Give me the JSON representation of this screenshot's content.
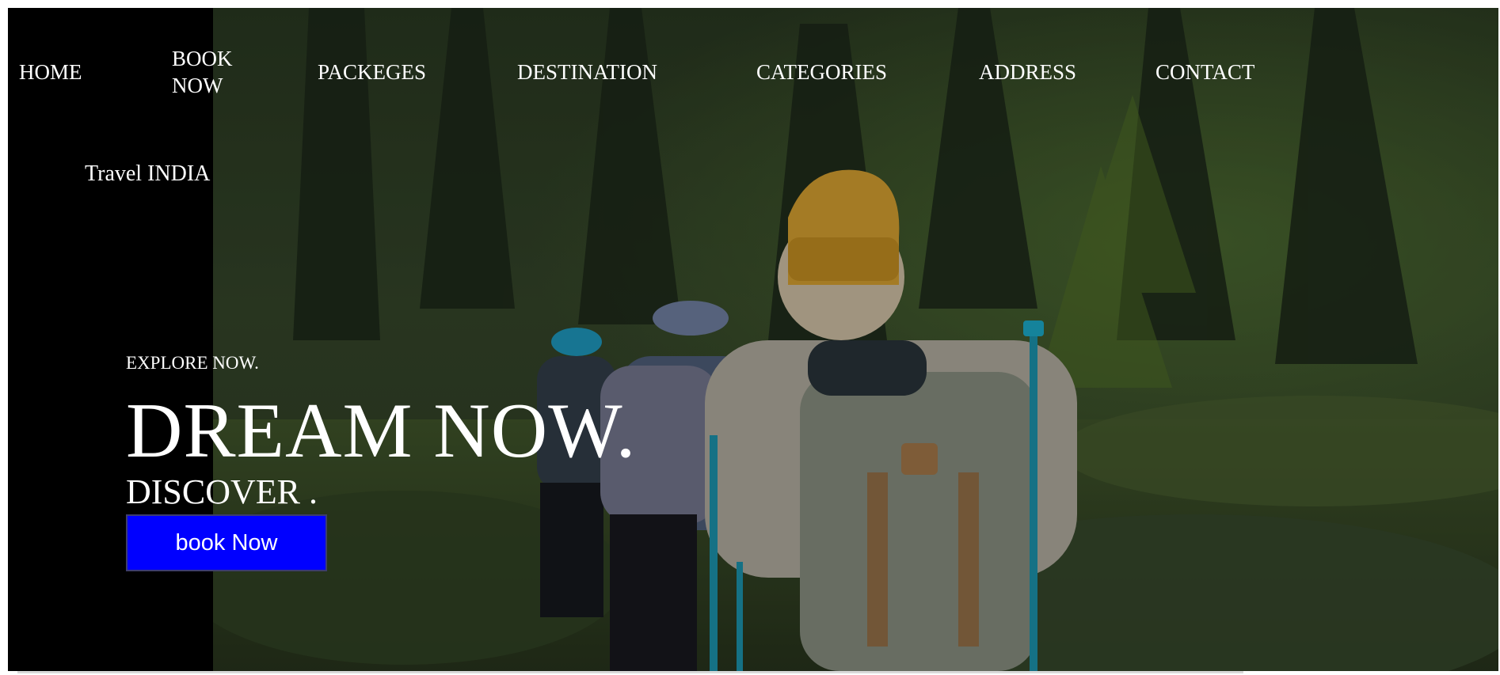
{
  "nav": {
    "items": [
      {
        "label": "HOME"
      },
      {
        "label": "BOOK NOW"
      },
      {
        "label": "PACKEGES"
      },
      {
        "label": "DESTINATION"
      },
      {
        "label": "CATEGORIES"
      },
      {
        "label": "ADDRESS"
      },
      {
        "label": "CONTACT"
      }
    ]
  },
  "brand": {
    "label": "Travel INDIA"
  },
  "hero": {
    "eyebrow": "EXPLORE NOW.",
    "headline": "DREAM NOW.",
    "subline": "DISCOVER .",
    "button_label": "book Now"
  },
  "colors": {
    "sidebar": "#000000",
    "button": "#0000ff",
    "text": "#ffffff",
    "forest_dark": "#1f2a1c",
    "forest_mid": "#3b4a2f",
    "hat": "#c9962e",
    "backpack": "#8e9488",
    "pole": "#1a8aa3"
  }
}
